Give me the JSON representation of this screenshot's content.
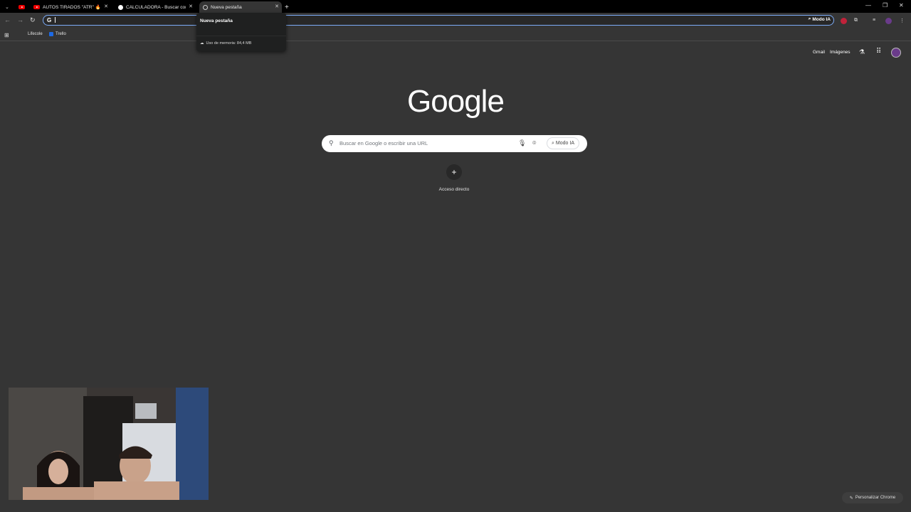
{
  "tabs": [
    {
      "title": "",
      "icon": "youtube-icon"
    },
    {
      "title": "AUTOS TIRADOS \"ATR\" 🔥 ¡CIC",
      "icon": "youtube-icon"
    },
    {
      "title": "CALCULADORA - Buscar con G",
      "icon": "google-icon"
    },
    {
      "title": "Nueva pestaña",
      "icon": "chrome-globe-icon",
      "active": true
    }
  ],
  "omnibox": {
    "g_label": "G",
    "ai_mode_label": "Modo IA"
  },
  "bookmarks": [
    {
      "label": "Lifecole"
    },
    {
      "label": "Trello"
    }
  ],
  "tab_hover_card": {
    "title": "Nueva pestaña",
    "memory": "Uso de memoria: 84,4 MB"
  },
  "top_links": {
    "gmail": "Gmail",
    "images": "Imágenes"
  },
  "logo": "Google",
  "search": {
    "placeholder": "Buscar en Google o escribir una URL",
    "ai_mode": "Modo IA"
  },
  "shortcut": {
    "label": "Acceso directo"
  },
  "customize": "Personalizar Chrome",
  "colors": {
    "background": "#353535",
    "accent": "#7cacf8",
    "tabstrip": "#000000"
  }
}
